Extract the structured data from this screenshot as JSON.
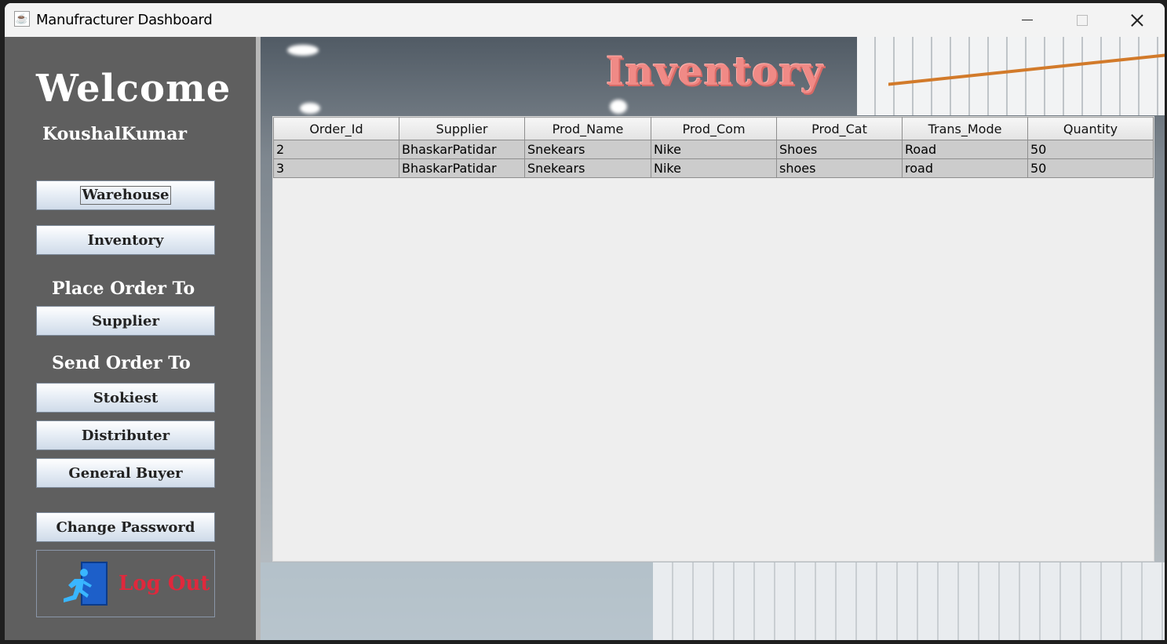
{
  "window": {
    "title": "Manufracturer Dashboard",
    "app_icon": "java-cup-icon"
  },
  "sidebar": {
    "welcome": "Welcome",
    "username": "KoushalKumar",
    "warehouse_label": "Warehouse",
    "inventory_label": "Inventory",
    "place_order_heading": "Place Order To",
    "supplier_label": "Supplier",
    "send_order_heading": "Send Order To",
    "stokiest_label": "Stokiest",
    "distributer_label": "Distributer",
    "general_buyer_label": "General Buyer",
    "change_password_label": "Change Password",
    "logout_label": "Log Out",
    "logout_icon": "exit-door-icon"
  },
  "main": {
    "title": "Inventory",
    "table": {
      "columns": [
        "Order_Id",
        "Supplier",
        "Prod_Name",
        "Prod_Com",
        "Prod_Cat",
        "Trans_Mode",
        "Quantity"
      ],
      "rows": [
        [
          "2",
          "BhaskarPatidar",
          "Snekears",
          "Nike",
          "Shoes",
          "Road",
          "50"
        ],
        [
          "3",
          "BhaskarPatidar",
          "Snekears",
          "Nike",
          "shoes",
          "road",
          "50"
        ]
      ]
    }
  },
  "colors": {
    "sidebar_bg": "#5f5f5f",
    "title_color": "#f08a86",
    "logout_color": "#e0283c"
  }
}
